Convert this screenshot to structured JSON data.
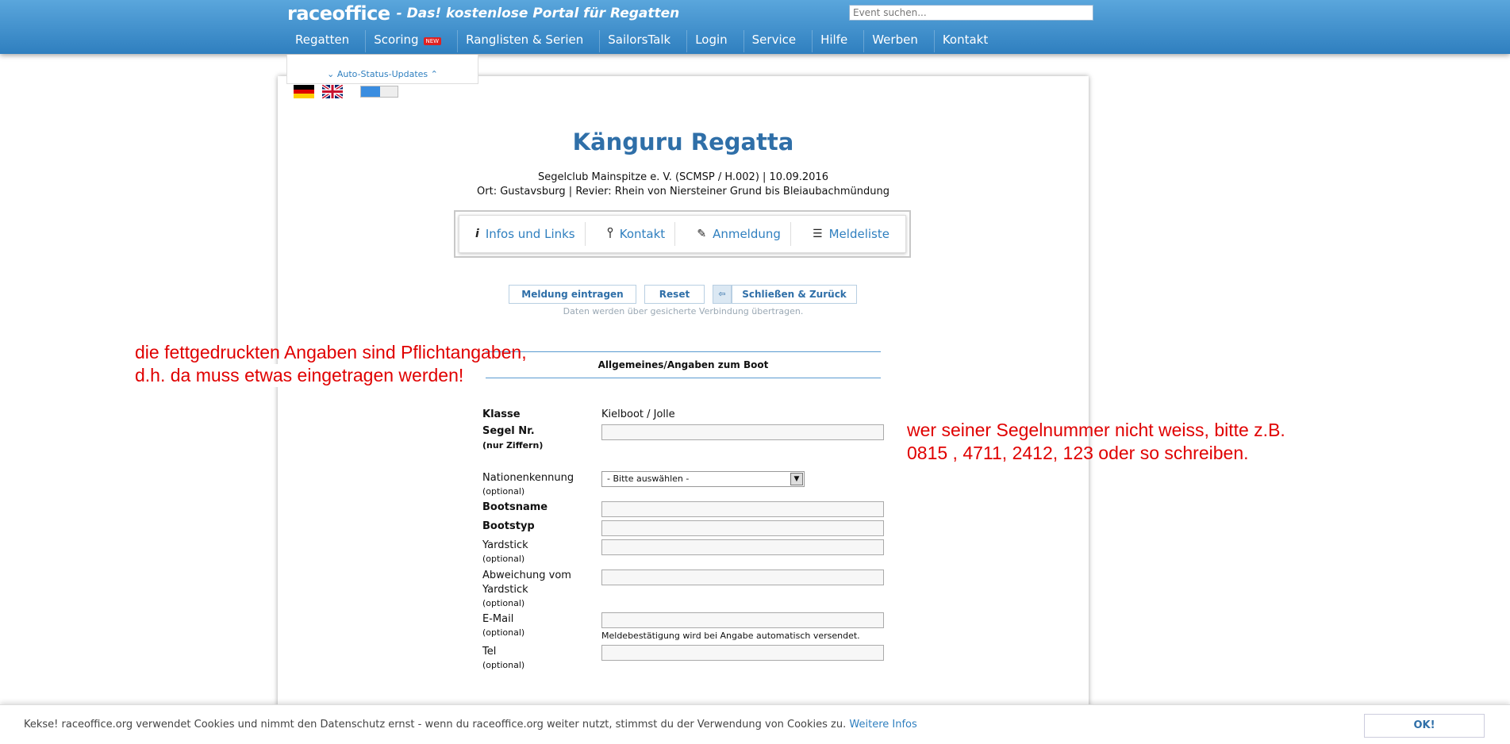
{
  "header": {
    "brand": "raceoffice",
    "tagline": "- Das! kostenlose Portal für Regatten",
    "search_placeholder": "Event suchen...",
    "nav": [
      {
        "label": "Regatten"
      },
      {
        "label": "Scoring",
        "badge": "NEW"
      },
      {
        "label": "Ranglisten & Serien"
      },
      {
        "label": "SailorsTalk"
      },
      {
        "label": "Login"
      },
      {
        "label": "Service"
      },
      {
        "label": "Hilfe"
      },
      {
        "label": "Werben"
      },
      {
        "label": "Kontakt"
      }
    ],
    "auto_status": "⌄ Auto-Status-Updates ⌃"
  },
  "event": {
    "title": "Känguru Regatta",
    "line1": "Segelclub Mainspitze e. V. (SCMSP / H.002) | 10.09.2016",
    "line2": "Ort: Gustavsburg | Revier: Rhein von Niersteiner Grund bis Bleiaubachmündung"
  },
  "tabs": [
    {
      "label": "Infos und Links",
      "icon": "info-icon",
      "glyph": "i"
    },
    {
      "label": "Kontakt",
      "icon": "pin-icon",
      "glyph": "📍"
    },
    {
      "label": "Anmeldung",
      "icon": "pencil-icon",
      "glyph": "✎"
    },
    {
      "label": "Meldeliste",
      "icon": "list-icon",
      "glyph": "☰"
    }
  ],
  "actions": {
    "submit": "Meldung eintragen",
    "reset": "Reset",
    "close": "Schließen & Zurück",
    "secure_note": "Daten werden über gesicherte Verbindung übertragen."
  },
  "form": {
    "section": "Allgemeines/Angaben zum Boot",
    "klasse_label": "Klasse",
    "klasse_value": "Kielboot / Jolle",
    "segel_label": "Segel Nr.",
    "segel_sub": "(nur Ziffern)",
    "nation_label": "Nationenkennung",
    "nation_select": "- Bitte auswählen -",
    "optional": "(optional)",
    "bootsname_label": "Bootsname",
    "bootstyp_label": "Bootstyp",
    "yardstick_label": "Yardstick",
    "abweichung_label_1": "Abweichung vom",
    "abweichung_label_2": "Yardstick",
    "email_label": "E-Mail",
    "email_hint": "Meldebestätigung wird bei Angabe automatisch versendet.",
    "tel_label": "Tel"
  },
  "annotations": {
    "left_1": "die fettgedruckten Angaben sind Pflichtangaben,",
    "left_2": "d.h. da muss etwas eingetragen werden!",
    "right_1": "wer seiner Segelnummer nicht weiss, bitte z.B.",
    "right_2": "0815 , 4711, 2412, 123 oder so schreiben."
  },
  "cookie": {
    "text": "Kekse! raceoffice.org verwendet Cookies und nimmt den Datenschutz ernst - wenn du raceoffice.org weiter nutzt, stimmst du der Verwendung von Cookies zu.",
    "link": "Weitere Infos",
    "ok": "OK!"
  },
  "colors": {
    "header_top": "#5aa6dc",
    "header_bottom": "#2f7fbf",
    "title": "#2f6fa8",
    "annotation": "#e00000"
  }
}
